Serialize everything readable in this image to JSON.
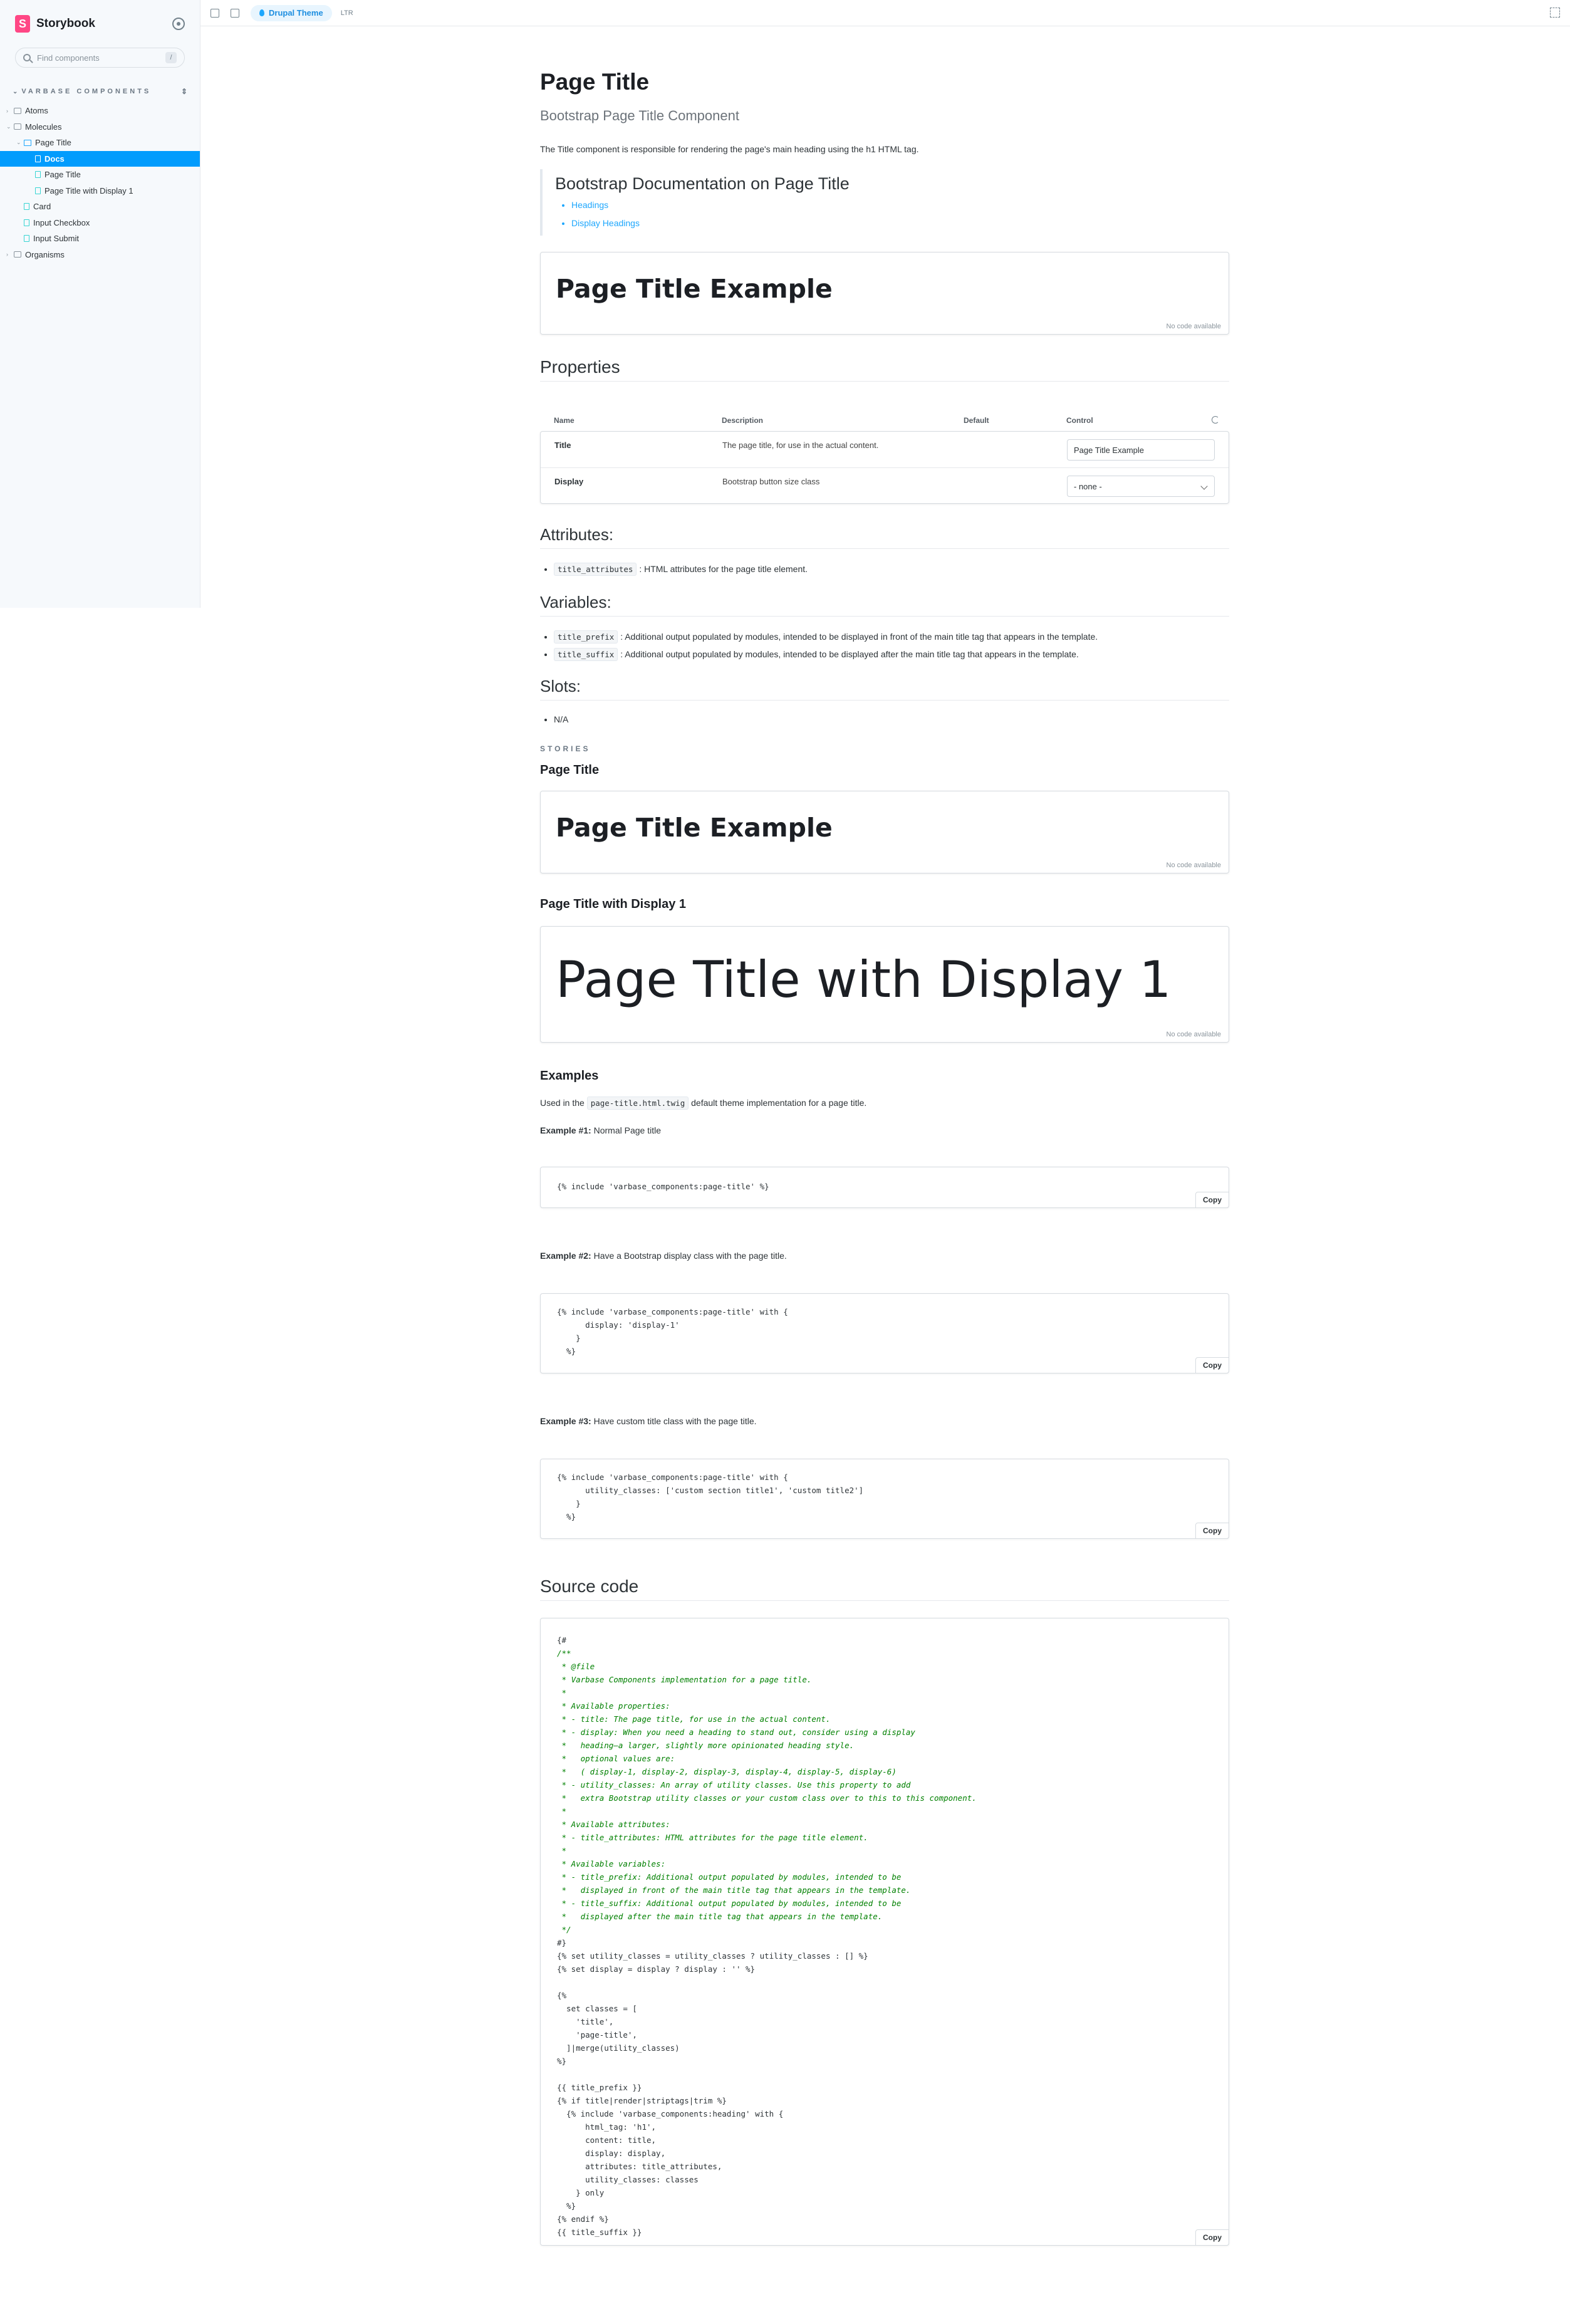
{
  "sidebar": {
    "brand": "Storybook",
    "logo_letter": "S",
    "search_placeholder": "Find components",
    "search_shortcut": "/",
    "section": "VARBASE COMPONENTS",
    "items": [
      {
        "label": "Atoms"
      },
      {
        "label": "Molecules"
      },
      {
        "label": "Page Title"
      },
      {
        "label": "Docs"
      },
      {
        "label": "Page Title"
      },
      {
        "label": "Page Title with Display 1"
      },
      {
        "label": "Card"
      },
      {
        "label": "Input Checkbox"
      },
      {
        "label": "Input Submit"
      },
      {
        "label": "Organisms"
      }
    ]
  },
  "toolbar": {
    "theme_pill": "Drupal Theme",
    "rtl": "LTR"
  },
  "doc": {
    "title": "Page Title",
    "subtitle": "Bootstrap Page Title Component",
    "intro": "The Title component is responsible for rendering the page's main heading using the h1 HTML tag.",
    "bootstrap_heading": "Bootstrap Documentation on Page Title",
    "bootstrap_links": [
      "Headings",
      "Display Headings"
    ],
    "preview_text": "Page Title Example",
    "no_code": "No code available",
    "properties_heading": "Properties",
    "props_table": {
      "headers": [
        "Name",
        "Description",
        "Default",
        "Control"
      ],
      "rows": [
        {
          "name": "Title",
          "description": "The page title, for use in the actual content.",
          "control": "Page Title Example"
        },
        {
          "name": "Display",
          "description": "Bootstrap button size class",
          "control": "- none -"
        }
      ]
    },
    "attributes_heading": "Attributes:",
    "attributes": [
      {
        "code": "title_attributes",
        "text": ": HTML attributes for the page title element."
      }
    ],
    "variables_heading": "Variables:",
    "variables": [
      {
        "code": "title_prefix",
        "text": ": Additional output populated by modules, intended to be displayed in front of the main title tag that appears in the template."
      },
      {
        "code": "title_suffix",
        "text": ": Additional output populated by modules, intended to be displayed after the main title tag that appears in the template."
      }
    ],
    "slots_heading": "Slots:",
    "slots": [
      "N/A"
    ],
    "stories_label": "STORIES",
    "story1_heading": "Page Title",
    "story1_text": "Page Title Example",
    "story2_heading": "Page Title with Display 1",
    "story2_text": "Page Title with Display 1",
    "examples_heading": "Examples",
    "examples_intro_pre": "Used in the",
    "examples_intro_code": "page-title.html.twig",
    "examples_intro_post": "default theme implementation for a page title.",
    "example1_label": "Example #1:",
    "example1_text": "Normal Page title",
    "example1_code": "{% include 'varbase_components:page-title' %}",
    "example2_label": "Example #2:",
    "example2_text": "Have a Bootstrap display class with the page title.",
    "example2_code": "{% include 'varbase_components:page-title' with {\n      display: 'display-1'\n    }\n  %}",
    "example3_label": "Example #3:",
    "example3_text": "Have custom title class with the page title.",
    "example3_code": "{% include 'varbase_components:page-title' with {\n      utility_classes: ['custom section title1', 'custom title2']\n    }\n  %}",
    "source_heading": "Source code",
    "copy_label": "Copy",
    "source_comment": "/**\n * @file\n * Varbase Components implementation for a page title.\n *\n * Available properties:\n * - title: The page title, for use in the actual content.\n * - display: When you need a heading to stand out, consider using a display\n *   heading—a larger, slightly more opinionated heading style.\n *   optional values are:\n *   ( display-1, display-2, display-3, display-4, display-5, display-6)\n * - utility_classes: An array of utility classes. Use this property to add\n *   extra Bootstrap utility classes or your custom class over to this to this component.\n *\n * Available attributes:\n * - title_attributes: HTML attributes for the page title element.\n *\n * Available variables:\n * - title_prefix: Additional output populated by modules, intended to be\n *   displayed in front of the main title tag that appears in the template.\n * - title_suffix: Additional output populated by modules, intended to be\n *   displayed after the main title tag that appears in the template.\n */",
    "source_open": "{#",
    "source_close": "#}",
    "source_part2": "{% set utility_classes = utility_classes ? utility_classes : [] %}\n{% set display = display ? display : '' %}\n\n{%\n  set classes = [\n    'title',\n    'page-title',\n  ]|merge(utility_classes)\n%}\n\n{{ title_prefix }}\n{% if title|render|striptags|trim %}\n  {% include 'varbase_components:heading' with {\n      html_tag: 'h1',\n      content: title,\n      display: display,\n      attributes: title_attributes,\n      utility_classes: classes\n    } only\n  %}\n{% endif %}\n{{ title_suffix }}"
  },
  "colors": {
    "accent": "#029cfd",
    "brand": "#ff4785",
    "comment": "#008000"
  }
}
